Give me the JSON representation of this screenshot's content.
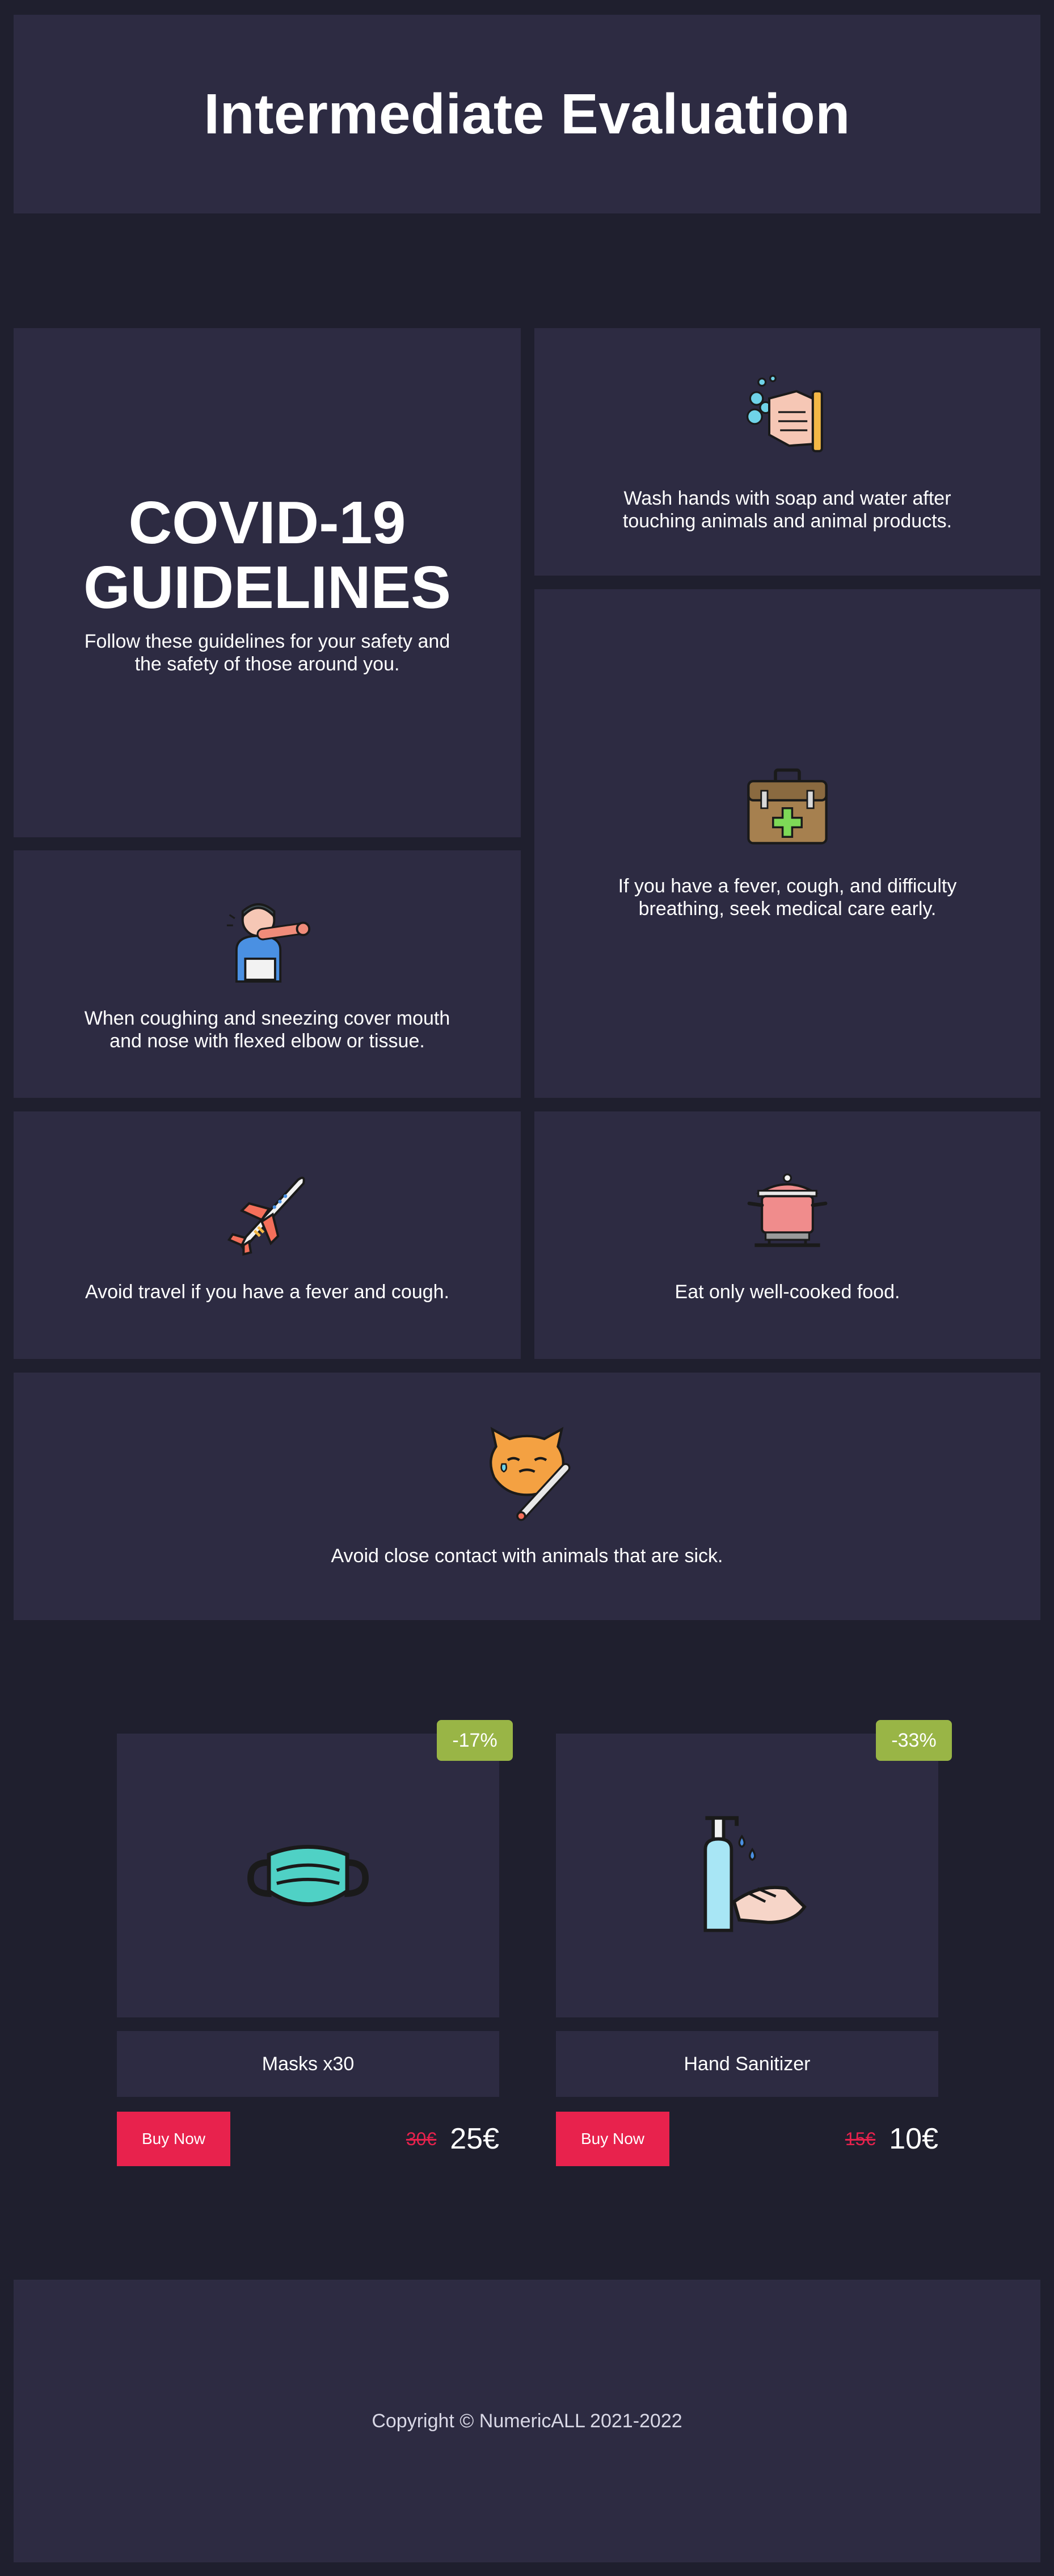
{
  "header": {
    "title": "Intermediate Evaluation"
  },
  "hero": {
    "title_line1": "COVID-19",
    "title_line2": "GUIDELINES",
    "subtitle": "Follow these guidelines for your safety and the safety of those around you."
  },
  "guidelines": [
    {
      "icon": "washing-hands-icon",
      "text": "Wash hands with soap and water after touching animals and animal products."
    },
    {
      "icon": "first-aid-kit-icon",
      "text": "If you have a fever, cough, and difficulty breathing, seek medical care early."
    },
    {
      "icon": "sneezing-person-icon",
      "text": "When coughing and sneezing cover mouth and nose with flexed elbow or tissue."
    },
    {
      "icon": "airplane-icon",
      "text": "Avoid travel if you have a fever and cough."
    },
    {
      "icon": "cooking-pot-icon",
      "text": "Eat only well-cooked food."
    },
    {
      "icon": "sick-cat-icon",
      "text": "Avoid close contact with animals that are sick."
    }
  ],
  "products": [
    {
      "name": "Masks x30",
      "discount": "-17%",
      "old_price": "30€",
      "new_price": "25€",
      "button": "Buy Now",
      "icon": "face-mask-icon"
    },
    {
      "name": "Hand Sanitizer",
      "discount": "-33%",
      "old_price": "15€",
      "new_price": "10€",
      "button": "Buy Now",
      "icon": "hand-sanitizer-icon"
    }
  ],
  "footer": {
    "copyright": "Copyright © NumericALL 2021-2022"
  },
  "colors": {
    "background": "#1f1f2e",
    "panel": "#2d2b42",
    "accent": "#e8224d",
    "badge": "#99b546"
  }
}
